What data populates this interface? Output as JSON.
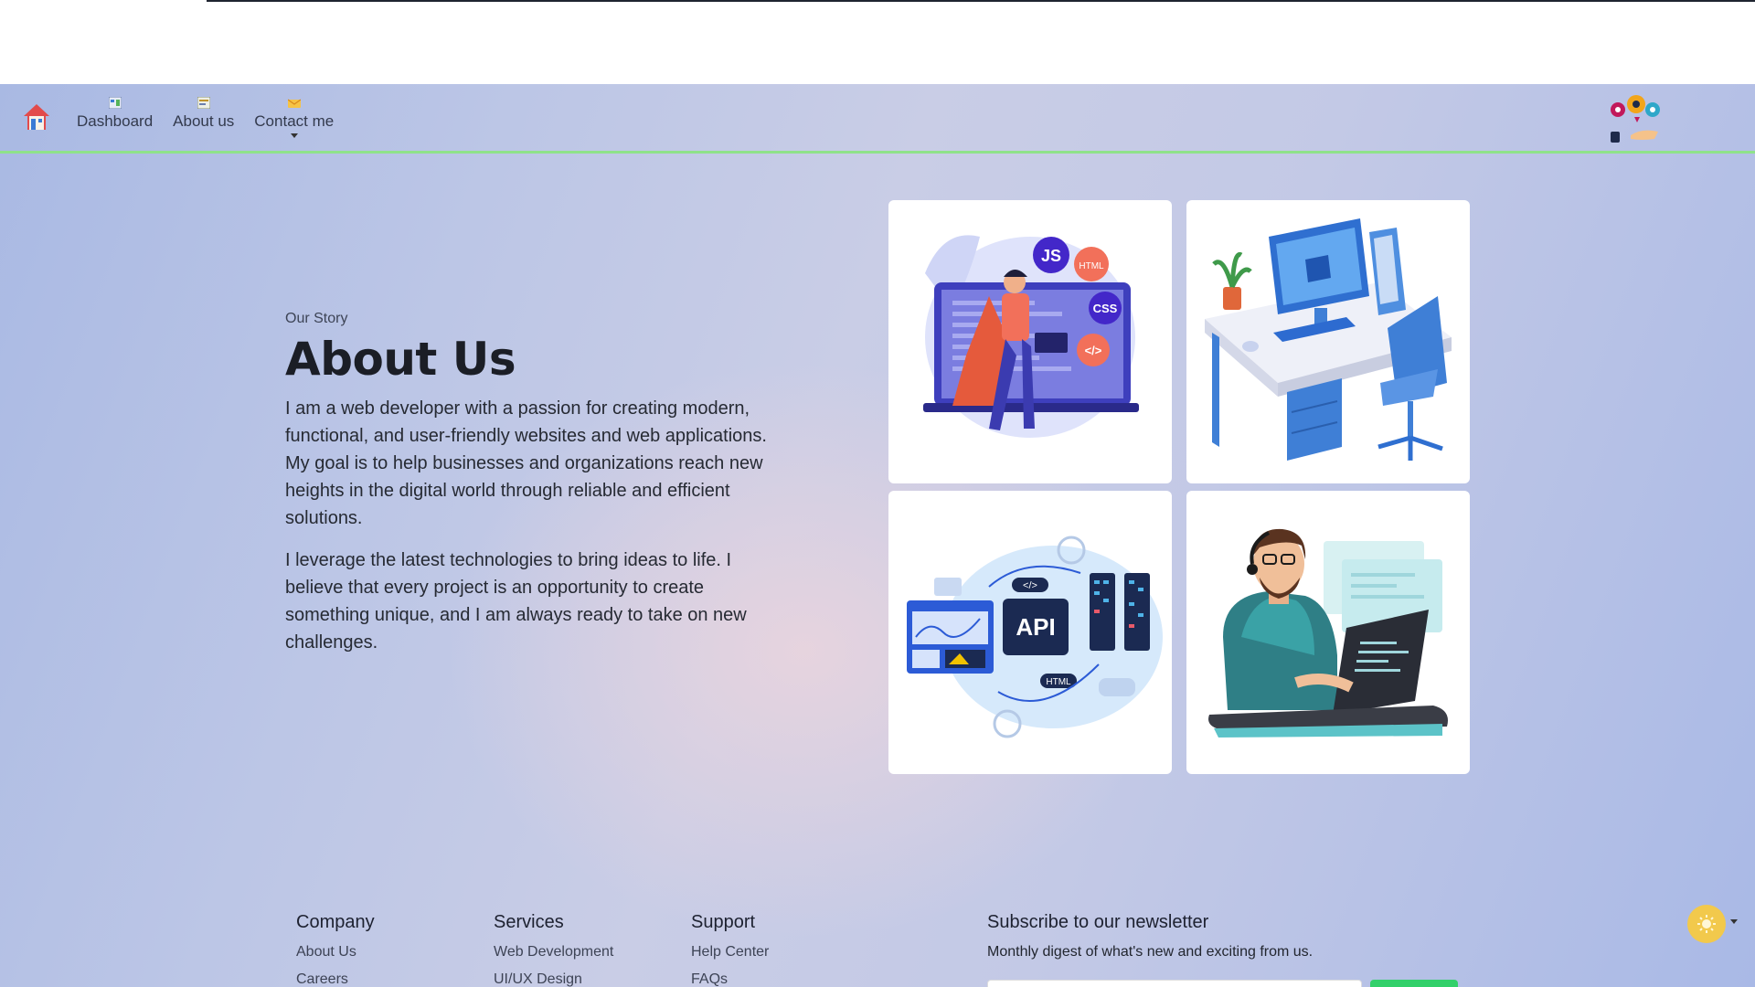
{
  "nav": {
    "items": [
      {
        "label": "Dashboard",
        "icon": "dashboard-icon"
      },
      {
        "label": "About us",
        "icon": "about-icon"
      },
      {
        "label": "Contact me",
        "icon": "contact-icon",
        "has_dropdown": true
      }
    ]
  },
  "about": {
    "eyebrow": "Our Story",
    "title": "About Us",
    "paragraph_1": "I am a web developer with a passion for creating modern, functional, and user-friendly websites and web applications. My goal is to help businesses and organizations reach new heights in the digital world through reliable and efficient solutions.",
    "paragraph_2": "I leverage the latest technologies to bring ideas to life. I believe that every project is an opportunity to create something unique, and I am always ready to take on new challenges."
  },
  "illustrations": {
    "card_1": {
      "badges": [
        "JS",
        "HTML",
        "CSS",
        "</>"
      ]
    },
    "card_3": {
      "badges": [
        "API",
        "</>",
        "HTML"
      ]
    }
  },
  "footer": {
    "company": {
      "title": "Company",
      "links": [
        "About Us",
        "Careers"
      ]
    },
    "services": {
      "title": "Services",
      "links": [
        "Web Development",
        "UI/UX Design"
      ]
    },
    "support": {
      "title": "Support",
      "links": [
        "Help Center",
        "FAQs"
      ]
    },
    "newsletter": {
      "title": "Subscribe to our newsletter",
      "description": "Monthly digest of what's new and exciting from us."
    }
  },
  "colors": {
    "nav_border": "#8fe28a",
    "subscribe_button": "#32d06a",
    "theme_toggle": "#f2c94c"
  }
}
